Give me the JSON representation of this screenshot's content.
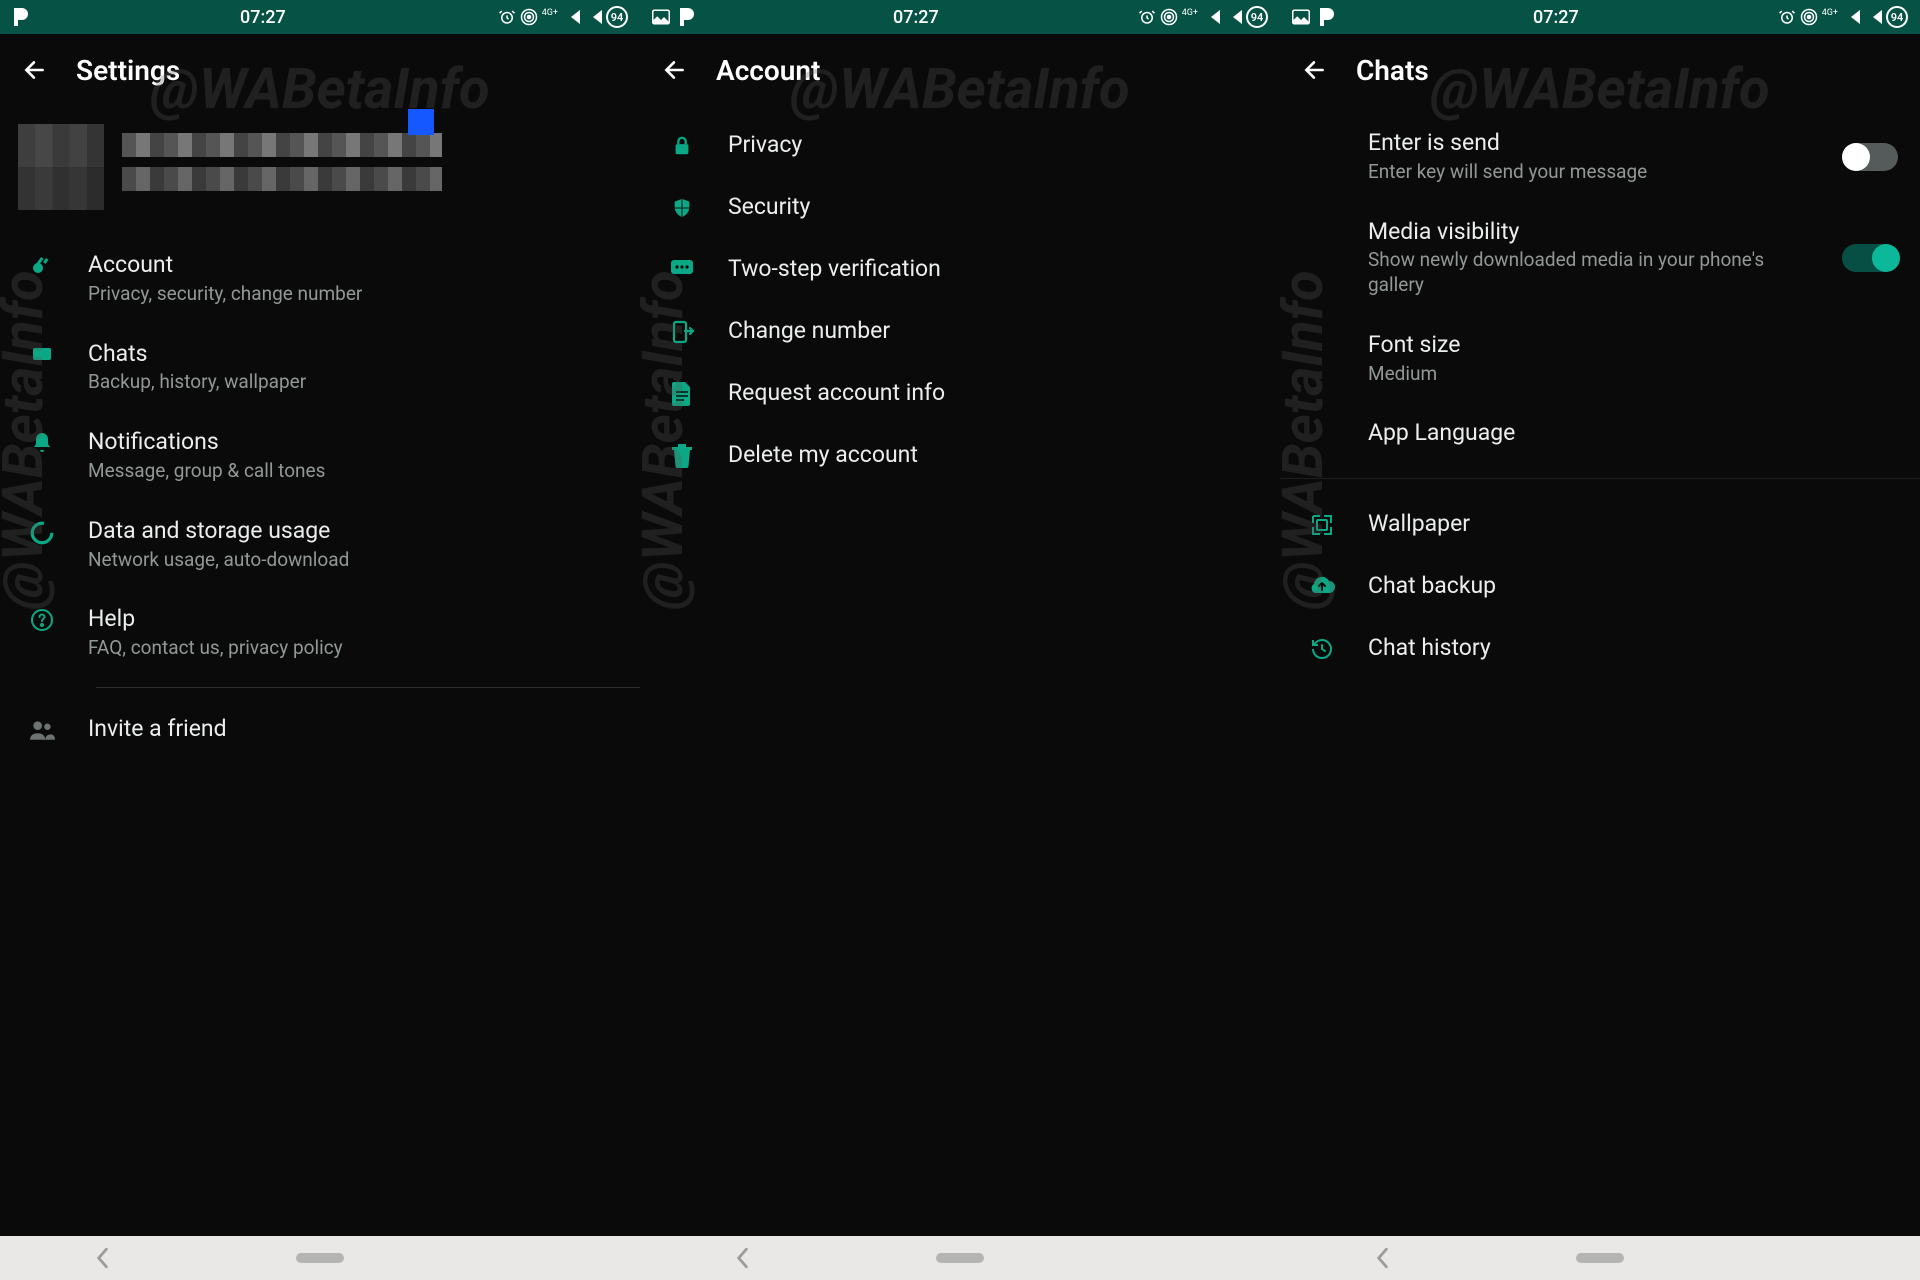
{
  "status": {
    "time": "07:27",
    "battery_badge": "94",
    "net_label": "4G+"
  },
  "watermark": "@WABetaInfo",
  "screens": {
    "settings": {
      "title": "Settings",
      "items": [
        {
          "icon": "key",
          "title": "Account",
          "sub": "Privacy, security, change number"
        },
        {
          "icon": "chat",
          "title": "Chats",
          "sub": "Backup, history, wallpaper"
        },
        {
          "icon": "bell",
          "title": "Notifications",
          "sub": "Message, group & call tones"
        },
        {
          "icon": "data",
          "title": "Data and storage usage",
          "sub": "Network usage, auto-download"
        },
        {
          "icon": "help",
          "title": "Help",
          "sub": "FAQ, contact us, privacy policy"
        }
      ],
      "invite": {
        "title": "Invite a friend"
      }
    },
    "account": {
      "title": "Account",
      "items": [
        {
          "icon": "lock",
          "title": "Privacy"
        },
        {
          "icon": "shield",
          "title": "Security"
        },
        {
          "icon": "pin",
          "title": "Two-step verification"
        },
        {
          "icon": "sim",
          "title": "Change number"
        },
        {
          "icon": "doc",
          "title": "Request account info"
        },
        {
          "icon": "trash",
          "title": "Delete my account"
        }
      ]
    },
    "chats": {
      "title": "Chats",
      "toggles": [
        {
          "title": "Enter is send",
          "sub": "Enter key will send your message",
          "on": false
        },
        {
          "title": "Media visibility",
          "sub": "Show newly downloaded media in your phone's gallery",
          "on": true
        }
      ],
      "font": {
        "title": "Font size",
        "sub": "Medium"
      },
      "lang": {
        "title": "App Language"
      },
      "more": [
        {
          "icon": "wallpaper",
          "title": "Wallpaper"
        },
        {
          "icon": "cloud",
          "title": "Chat backup"
        },
        {
          "icon": "history",
          "title": "Chat history"
        }
      ]
    }
  }
}
